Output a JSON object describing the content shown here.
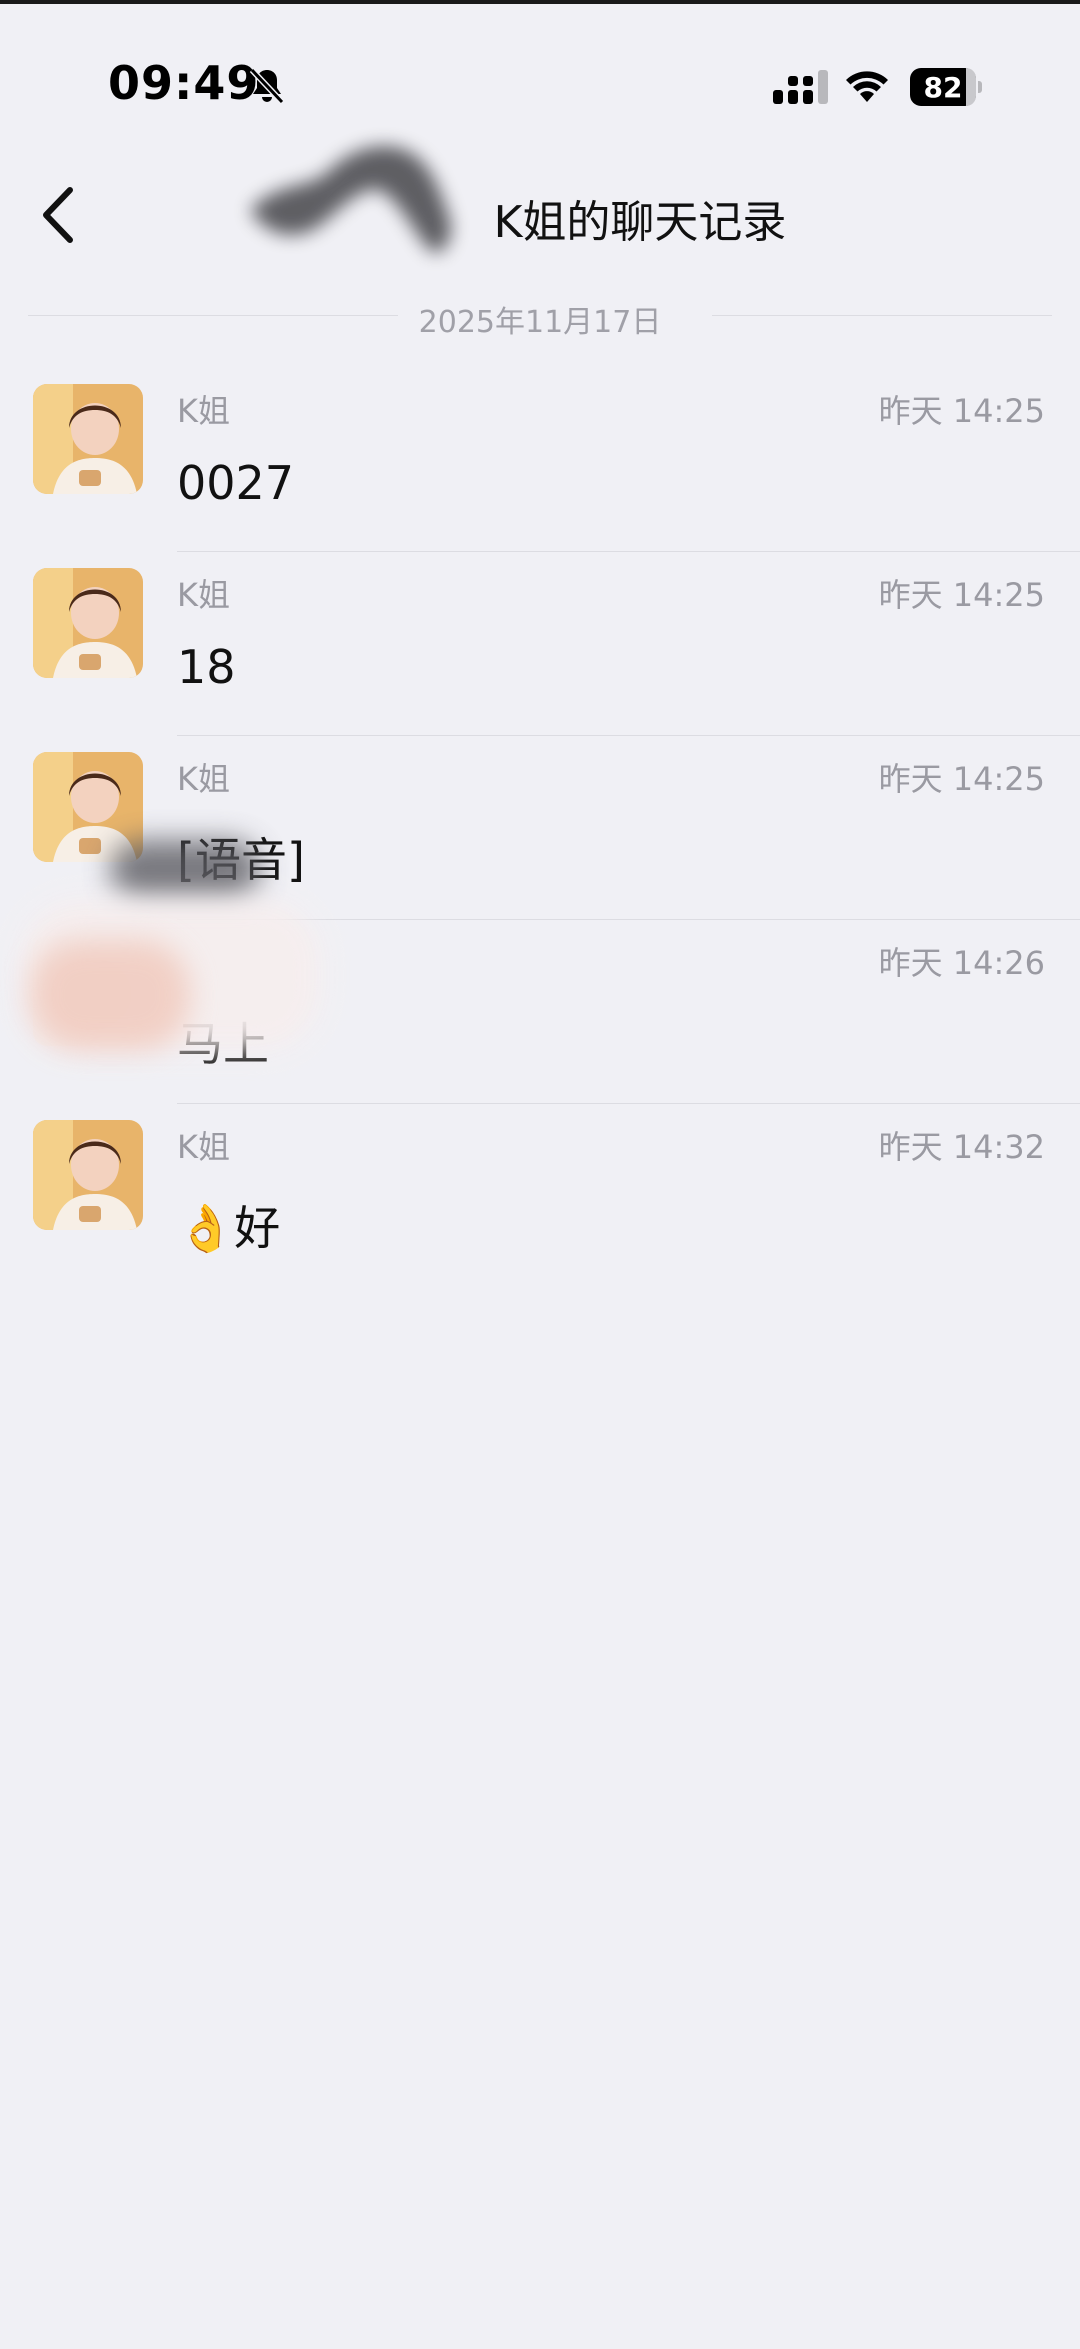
{
  "status_bar": {
    "time": "09:49",
    "battery": "82",
    "icons": [
      "bell-slash-icon",
      "signal-icon",
      "wifi-icon",
      "battery-icon"
    ]
  },
  "nav": {
    "title": "K姐的聊天记录",
    "back_icon": "chevron-left-icon"
  },
  "date_separator": "2025年11月17日",
  "messages": [
    {
      "sender": "K姐",
      "time": "昨天 14:25",
      "text": "0027"
    },
    {
      "sender": "K姐",
      "time": "昨天 14:25",
      "text": "18"
    },
    {
      "sender": "K姐",
      "time": "昨天 14:25",
      "text": "[语音]"
    },
    {
      "sender": "",
      "time": "昨天 14:26",
      "text": "马上"
    },
    {
      "sender": "K姐",
      "time": "昨天 14:32",
      "text": "👌好"
    }
  ],
  "colors": {
    "background": "#f0f0f5",
    "secondary_text": "#9a9aa2",
    "primary_text": "#111111",
    "divider": "#dcdce2"
  }
}
